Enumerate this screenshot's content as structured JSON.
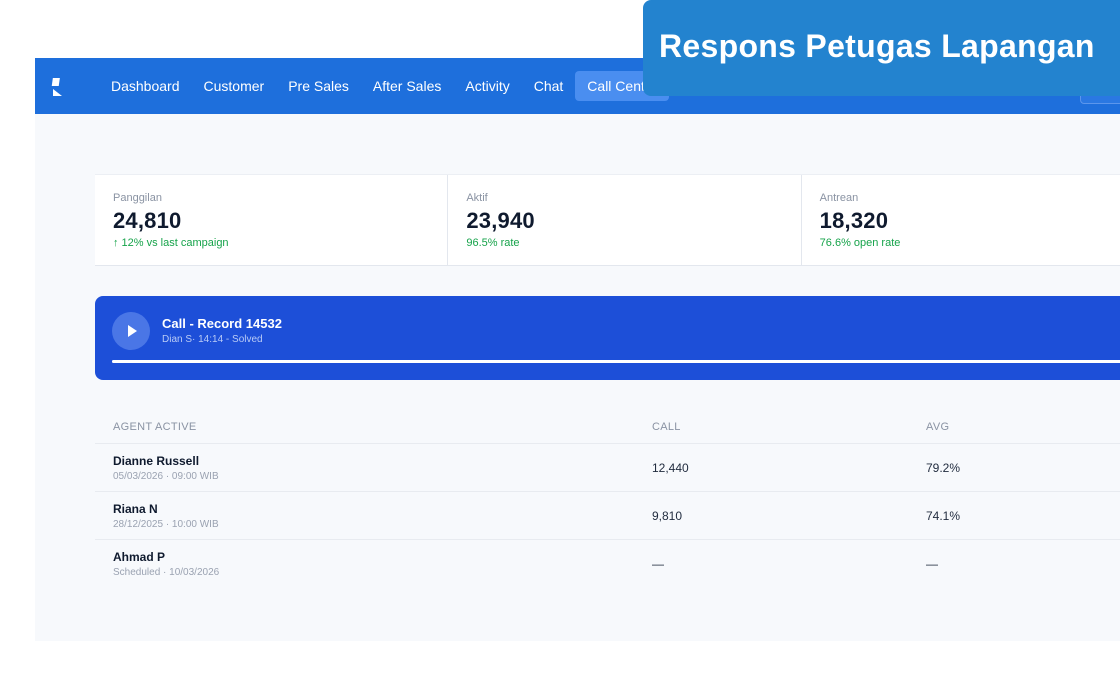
{
  "banner": {
    "title": "Respons Petugas Lapangan"
  },
  "nav": {
    "items": [
      {
        "label": "Dashboard"
      },
      {
        "label": "Customer"
      },
      {
        "label": "Pre Sales"
      },
      {
        "label": "After Sales"
      },
      {
        "label": "Activity"
      },
      {
        "label": "Chat"
      },
      {
        "label": "Call Center"
      }
    ],
    "active_index": 6,
    "color": "#1e6fdc"
  },
  "stats": [
    {
      "label": "Panggilan",
      "value": "24,810",
      "sub": "↑ 12% vs last campaign"
    },
    {
      "label": "Aktif",
      "value": "23,940",
      "sub": "96.5% rate"
    },
    {
      "label": "Antrean",
      "value": "18,320",
      "sub": "76.6% open rate"
    }
  ],
  "player": {
    "title": "Call - Record 14532",
    "meta": "Dian S· 14:14 - Solved",
    "progress_fraction": 1.0,
    "color": "#1d4fd8"
  },
  "table": {
    "headers": [
      "AGENT ACTIVE",
      "CALL",
      "AVG"
    ],
    "rows": [
      {
        "name": "Dianne Russell",
        "sub": "05/03/2026 · 09:00 WIB",
        "call": "12,440",
        "avg": "79.2%"
      },
      {
        "name": "Riana N",
        "sub": "28/12/2025 · 10:00 WIB",
        "call": "9,810",
        "avg": "74.1%"
      },
      {
        "name": "Ahmad P",
        "sub": "Scheduled · 10/03/2026",
        "call": "—",
        "avg": "—"
      }
    ]
  }
}
